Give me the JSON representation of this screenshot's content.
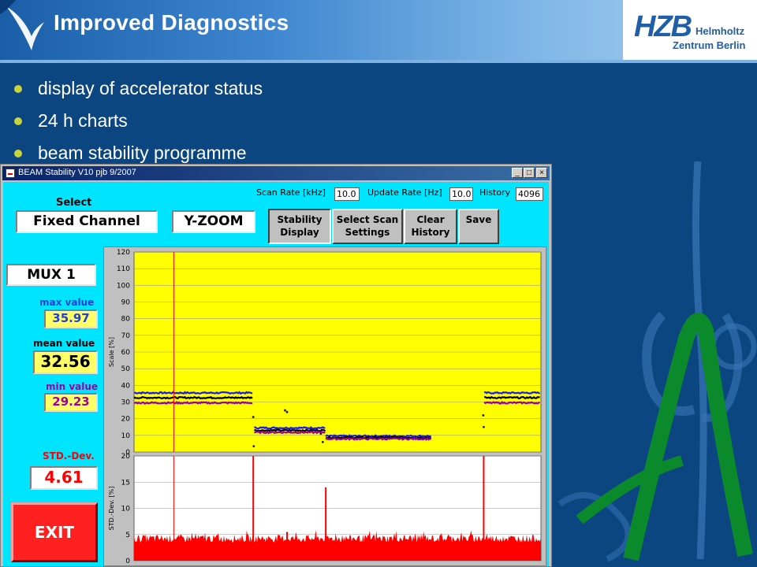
{
  "slide": {
    "title": "Improved Diagnostics",
    "bullets": [
      "display of accelerator status",
      "24 h charts",
      "beam stability programme"
    ],
    "logo": {
      "mark": "HZB",
      "line1": "Helmholtz",
      "line2": "Zentrum Berlin"
    }
  },
  "window": {
    "title": "BEAM Stability  V10 pjb 9/2007",
    "controls": [
      "_",
      "□",
      "×"
    ]
  },
  "rates": {
    "scan_label": "Scan Rate [kHz]",
    "scan_value": "10.0",
    "update_label": "Update Rate [Hz]",
    "update_value": "10.0",
    "history_label": "History",
    "history_value": "4096"
  },
  "select": {
    "label": "Select",
    "channel": "Fixed Channel",
    "zoom": "Y-ZOOM"
  },
  "buttons": {
    "stability": [
      "Stability",
      "Display"
    ],
    "scan": [
      "Select Scan",
      "Settings"
    ],
    "clear": [
      "Clear",
      "History"
    ],
    "save": "Save"
  },
  "mux": "MUX 1",
  "stats": {
    "max_label": "max value",
    "max_value": "35.97",
    "mean_label": "mean value",
    "mean_value": "32.56",
    "min_label": "min value",
    "min_value": "29.23",
    "std_label": "STD.-Dev.",
    "std_value": "4.61"
  },
  "exit_label": "EXIT",
  "colors": {
    "client_bg": "#00e5ff",
    "upper_plot_bg": "#ffff00",
    "lower_plot_bg": "#ffffff",
    "max_trace": "#1a1aff",
    "mean_trace": "#000000",
    "min_trace": "#990099",
    "std_trace": "#ff0000",
    "cursor": "#ff0000"
  },
  "chart_data": [
    {
      "type": "scatter",
      "ylabel": "Scale [%]",
      "ylim": [
        0,
        120
      ],
      "yticks": [
        0,
        10,
        20,
        30,
        40,
        50,
        60,
        70,
        80,
        90,
        100,
        110,
        120
      ],
      "xlim": [
        0,
        4096
      ],
      "grid": true,
      "cursor_x": 400,
      "series": [
        {
          "segments": [
            {
              "x": [
                0,
                1200
              ],
              "value": 35.5
            },
            {
              "x": [
                1210,
                1930
              ],
              "value": 14.5
            },
            {
              "x": [
                1930,
                3000
              ],
              "value": 9.6
            },
            {
              "x": [
                3525,
                4096
              ],
              "value": 35.5
            }
          ]
        },
        {
          "segments": [
            {
              "x": [
                0,
                1200
              ],
              "value": 32.6
            },
            {
              "x": [
                1210,
                1930
              ],
              "value": 13.0
            },
            {
              "x": [
                1930,
                3000
              ],
              "value": 8.7
            },
            {
              "x": [
                3525,
                4096
              ],
              "value": 32.6
            }
          ]
        },
        {
          "segments": [
            {
              "x": [
                0,
                1200
              ],
              "value": 29.5
            },
            {
              "x": [
                1210,
                1930
              ],
              "value": 11.8
            },
            {
              "x": [
                1930,
                3000
              ],
              "value": 7.9
            },
            {
              "x": [
                3525,
                4096
              ],
              "value": 29.5
            }
          ]
        }
      ],
      "outliers": [
        {
          "x": 1200,
          "y": 21
        },
        {
          "x": 1205,
          "y": 3.5
        },
        {
          "x": 1520,
          "y": 25
        },
        {
          "x": 1540,
          "y": 24
        },
        {
          "x": 1880,
          "y": 11
        },
        {
          "x": 1900,
          "y": 6
        },
        {
          "x": 3520,
          "y": 15
        },
        {
          "x": 3515,
          "y": 22
        }
      ]
    },
    {
      "type": "bar",
      "ylabel": "STD.-Dev. [%]",
      "ylim": [
        0,
        20
      ],
      "yticks": [
        0,
        5,
        10,
        15,
        20
      ],
      "xlim": [
        0,
        4096
      ],
      "grid": true,
      "cursor_x": 400,
      "baseline": 3.5,
      "noise_amplitude": 1.5,
      "spikes": [
        {
          "x": 1200,
          "value": 20
        },
        {
          "x": 1540,
          "value": 5.5
        },
        {
          "x": 1930,
          "value": 14
        },
        {
          "x": 3520,
          "value": 20
        }
      ]
    }
  ]
}
